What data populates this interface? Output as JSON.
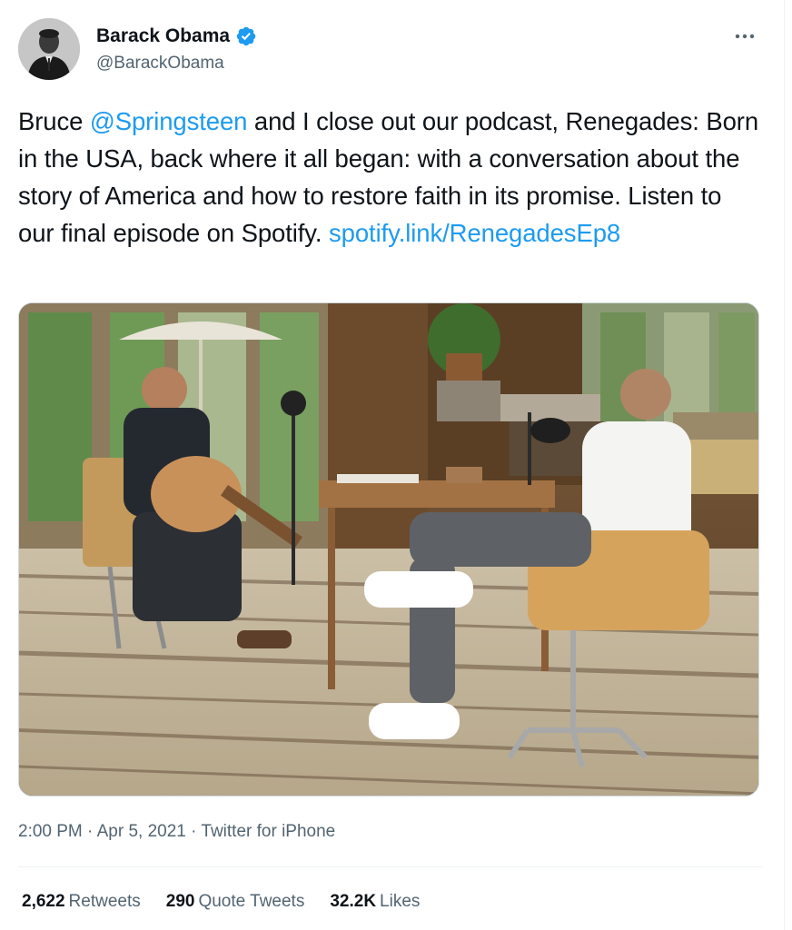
{
  "author": {
    "display_name": "Barack Obama",
    "handle": "@BarackObama",
    "verified": true,
    "avatar_icon": "profile-photo"
  },
  "more_icon": "more-horizontal-icon",
  "tweet": {
    "segments": [
      {
        "text": "Bruce ",
        "type": "text"
      },
      {
        "text": "@Springsteen",
        "type": "mention"
      },
      {
        "text": " and I close out our podcast, Renegades: Born in the USA, back where it all began: with a conversation about the story of America and how to restore faith in its promise. Listen to our final episode on Spotify. ",
        "type": "text"
      },
      {
        "text": "spotify.link/RenegadesEp8",
        "type": "link"
      }
    ]
  },
  "media": {
    "type": "photo"
  },
  "meta": {
    "time": "2:00 PM",
    "date": "Apr 5, 2021",
    "source": "Twitter for iPhone",
    "separator": "·"
  },
  "stats": {
    "retweets": {
      "count": "2,622",
      "label": "Retweets"
    },
    "quote_tweets": {
      "count": "290",
      "label": "Quote Tweets"
    },
    "likes": {
      "count": "32.2K",
      "label": "Likes"
    }
  },
  "colors": {
    "link": "#1d9bf0",
    "verified": "#1d9bf0",
    "secondary_text": "#536471",
    "primary_text": "#0f1419"
  }
}
